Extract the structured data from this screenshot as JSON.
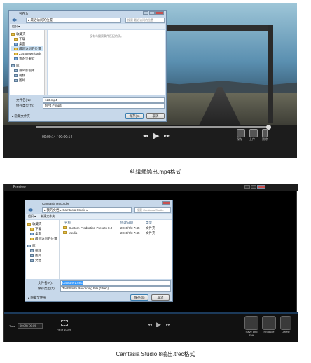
{
  "top": {
    "dialog": {
      "title": "另存为",
      "address": "▸ 最近访问的位置",
      "search_placeholder": "搜索 最近访问的位置",
      "toolbar_organize": "组织 ▾",
      "empty_msg": "没有与搜索条件匹配的项。",
      "nav_items": [
        {
          "label": "收藏夹",
          "icon": "star-icon"
        },
        {
          "label": "下载",
          "icon": "download-folder-icon"
        },
        {
          "label": "桌面",
          "icon": "desktop-icon"
        },
        {
          "label": "最近访问的位置",
          "icon": "recent-places-icon"
        },
        {
          "label": "2345Downloads",
          "icon": "folder-icon"
        },
        {
          "label": "我的坚果云",
          "icon": "cloud-folder-icon"
        },
        {
          "label": "库",
          "icon": "library-icon"
        },
        {
          "label": "暴风影视库",
          "icon": "library-video-icon"
        },
        {
          "label": "视频",
          "icon": "video-icon"
        },
        {
          "label": "图片",
          "icon": "picture-icon"
        }
      ],
      "filename_label": "文件名(N):",
      "filename_value": "123.mp4",
      "filetype_label": "保存类型(T):",
      "filetype_value": "MP4 (*.mp4)",
      "hide_folders": "隐藏文件夹",
      "save_btn": "保存(S)",
      "cancel_btn": "取消"
    },
    "player": {
      "time": "00:00:14 / 00:00:14",
      "buttons": [
        {
          "label": "保存",
          "icon": "save-icon"
        },
        {
          "label": "上传",
          "icon": "film-icon"
        },
        {
          "label": "删除",
          "icon": "delete-icon"
        }
      ]
    }
  },
  "caption_top": "剪辑师输出.mp4格式",
  "bottom": {
    "window_title": "Preview",
    "dialog": {
      "title": "Camtasia Recorder",
      "address": "▸ 我的文档 ▸ Camtasia Studio ▸",
      "search_placeholder": "搜索 Camtasia Studio",
      "toolbar_organize": "组织 ▾",
      "toolbar_newfolder": "新建文件夹",
      "col_name": "名称",
      "col_date": "修改日期",
      "col_type": "类型",
      "files": [
        {
          "name": "Custom Production Presets 8.0",
          "date": "2015/7/3 7:45",
          "type": "文件夹"
        },
        {
          "name": "Media",
          "date": "2015/7/3 7:45",
          "type": "文件夹"
        }
      ],
      "nav_items": [
        {
          "label": "收藏夹",
          "icon": "star-icon"
        },
        {
          "label": "下载",
          "icon": "download-folder-icon"
        },
        {
          "label": "桌面",
          "icon": "desktop-icon"
        },
        {
          "label": "最近访问的位置",
          "icon": "recent-places-icon"
        },
        {
          "label": "库",
          "icon": "library-icon"
        },
        {
          "label": "视频",
          "icon": "video-icon"
        },
        {
          "label": "图片",
          "icon": "picture-icon"
        },
        {
          "label": "文档",
          "icon": "document-icon"
        }
      ],
      "filename_label": "文件名(N):",
      "filename_value": "Capture-1.trec",
      "filetype_label": "保存类型(T):",
      "filetype_value": "TechSmith Recording File (*.trec)",
      "hide_folders": "隐藏文件夹",
      "save_btn": "保存(S)",
      "cancel_btn": "取消"
    },
    "player": {
      "time_label": "Time",
      "time_value": "00:09 / 00:09",
      "fit_label": "Fit or 100%",
      "buttons": [
        {
          "label": "Save and Edit",
          "icon": "save-edit-icon"
        },
        {
          "label": "Produce",
          "icon": "produce-icon"
        },
        {
          "label": "Delete",
          "icon": "trash-icon"
        }
      ]
    }
  },
  "caption_bottom": "Camtasia Studio 8输出.trec格式"
}
